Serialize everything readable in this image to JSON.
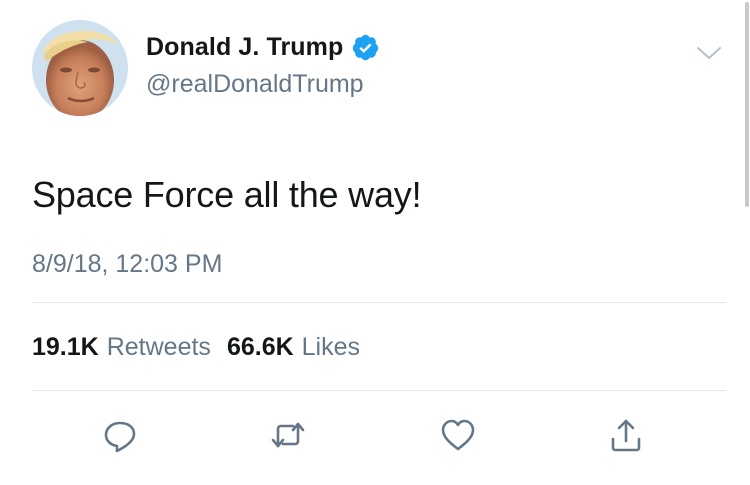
{
  "author": {
    "display_name": "Donald J. Trump",
    "handle": "@realDonaldTrump",
    "verified": true,
    "verified_badge_color": "#1da1f2"
  },
  "tweet": {
    "text": "Space Force all the way!",
    "timestamp": "8/9/18, 12:03 PM"
  },
  "stats": {
    "retweets_count": "19.1K",
    "retweets_label": "Retweets",
    "likes_count": "66.6K",
    "likes_label": "Likes"
  },
  "actions": [
    {
      "name": "reply",
      "icon": "reply-icon"
    },
    {
      "name": "retweet",
      "icon": "retweet-icon"
    },
    {
      "name": "like",
      "icon": "heart-icon"
    },
    {
      "name": "share",
      "icon": "share-icon"
    }
  ],
  "menu": {
    "icon": "chevron-down-icon"
  },
  "colors": {
    "text_primary": "#14171a",
    "text_secondary": "#657786",
    "divider": "#e1e8ed",
    "icon": "#657786"
  }
}
